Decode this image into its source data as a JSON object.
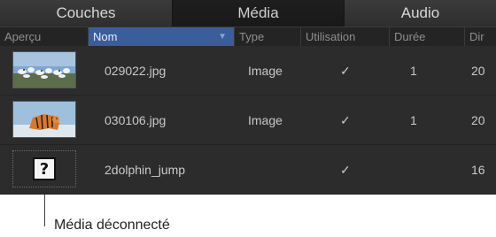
{
  "tabs": [
    {
      "label": "Couches"
    },
    {
      "label": "Média"
    },
    {
      "label": "Audio"
    }
  ],
  "columns": [
    {
      "label": "Aperçu"
    },
    {
      "label": "Nom",
      "sort": "▼"
    },
    {
      "label": "Type"
    },
    {
      "label": "Utilisation"
    },
    {
      "label": "Durée"
    },
    {
      "label": "Dir"
    }
  ],
  "rows": [
    {
      "name": "029022.jpg",
      "type": "Image",
      "used": "✓",
      "duration": "1",
      "extra": "20",
      "thumb": "birds-photo-icon"
    },
    {
      "name": "030106.jpg",
      "type": "Image",
      "used": "✓",
      "duration": "1",
      "extra": "20",
      "thumb": "tiger-photo-icon"
    },
    {
      "name": "2dolphin_jump",
      "type": "",
      "used": "✓",
      "duration": "",
      "extra": "16",
      "thumb": "missing-media-icon",
      "placeholder": "?"
    }
  ],
  "callout": {
    "label": "Média déconnecté"
  }
}
